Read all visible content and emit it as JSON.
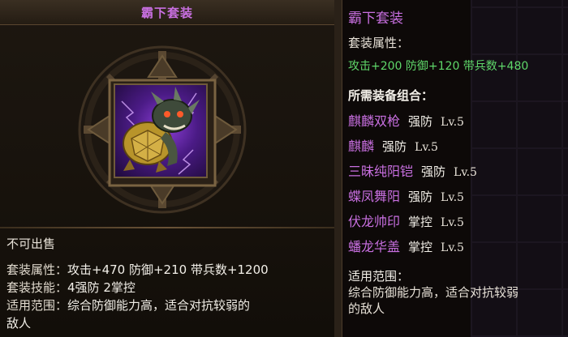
{
  "left": {
    "title": "霸下套装",
    "status": "不可出售",
    "set_attr_label": "套装属性：",
    "set_attr_value": "攻击+470  防御+210  带兵数+1200",
    "skill_label": "套装技能：",
    "skill_value": "4强防   2掌控",
    "range_label": "适用范围：",
    "range_line1": "综合防御能力高，适合对抗较弱的",
    "range_line2": "敌人"
  },
  "right": {
    "title": "霸下套装",
    "set_attr_label": "套装属性：",
    "set_attr_value": "攻击+200  防御+120  带兵数+480",
    "composition_label": "所需装备组合：",
    "components": [
      {
        "name": "麒麟双枪",
        "type": "强防",
        "level": "Lv.5"
      },
      {
        "name": "麒麟",
        "type": "强防",
        "level": "Lv.5"
      },
      {
        "name": "三昧纯阳铠",
        "type": "强防",
        "level": "Lv.5"
      },
      {
        "name": "蝶凤舞阳",
        "type": "强防",
        "level": "Lv.5"
      },
      {
        "name": "伏龙帅印",
        "type": "掌控",
        "level": "Lv.5"
      },
      {
        "name": "蟠龙华盖",
        "type": "掌控",
        "level": "Lv.5"
      }
    ],
    "range_label": "适用范围：",
    "range_line1": "综合防御能力高，适合对抗较弱",
    "range_line2": "的敌人"
  },
  "colors": {
    "title_purple": "#c86fe0",
    "attr_green": "#5fd86a",
    "text_white": "#f2efe8"
  },
  "icons": {
    "item": "dragon-turtle-icon",
    "frame": "ornate-medallion-frame"
  }
}
